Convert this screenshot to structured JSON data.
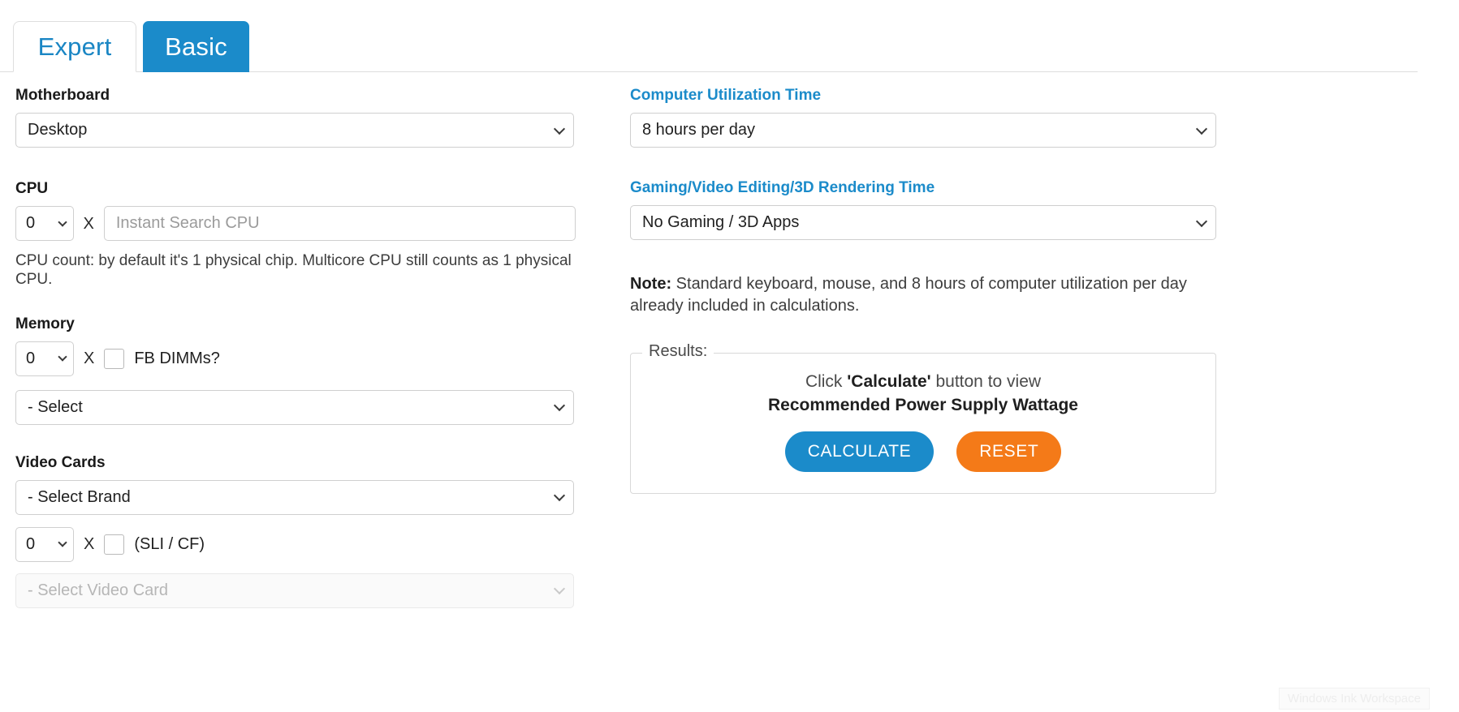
{
  "tabs": [
    {
      "label": "Expert",
      "active": false
    },
    {
      "label": "Basic",
      "active": true
    }
  ],
  "left_column": {
    "motherboard": {
      "label": "Motherboard",
      "select_value": "Desktop"
    },
    "cpu": {
      "label": "CPU",
      "count_value": "0",
      "multiplier": "X",
      "search_placeholder": "Instant Search CPU",
      "helper_text": "CPU count: by default it's 1 physical chip. Multicore CPU still counts as 1 physical CPU."
    },
    "memory": {
      "label": "Memory",
      "count_value": "0",
      "multiplier": "X",
      "fb_dimms_label": "FB DIMMs?",
      "fb_dimms_checked": false,
      "select_value": "- Select"
    },
    "video_cards": {
      "label": "Video Cards",
      "brand_value": "- Select Brand",
      "count_value": "0",
      "multiplier": "X",
      "sli_label": "(SLI / CF)",
      "sli_checked": false,
      "card_value": "- Select Video Card",
      "card_disabled": true
    }
  },
  "right_column": {
    "utilization": {
      "label": "Computer Utilization Time",
      "select_value": "8 hours per day"
    },
    "gaming": {
      "label": "Gaming/Video Editing/3D Rendering Time",
      "select_value": "No Gaming / 3D Apps"
    },
    "note": {
      "prefix": "Note:",
      "text": " Standard keyboard, mouse, and 8 hours of computer utilization per day already included in calculations."
    },
    "results": {
      "legend": "Results:",
      "line1_pre": "Click ",
      "line1_bold": "'Calculate'",
      "line1_post": " button to view",
      "line2": "Recommended Power Supply Wattage",
      "calculate_label": "CALCULATE",
      "reset_label": "RESET"
    }
  },
  "overlay": {
    "ink_workspace_label": "Windows Ink Workspace"
  },
  "colors": {
    "accent_blue": "#1b8bca",
    "tab_text_blue": "#1a86c4",
    "reset_orange": "#f47a18",
    "border_grey": "#cfcfcf",
    "text_dark": "#1f1f1f",
    "text_muted": "#3d3d3d",
    "placeholder": "#9b9b9b"
  }
}
